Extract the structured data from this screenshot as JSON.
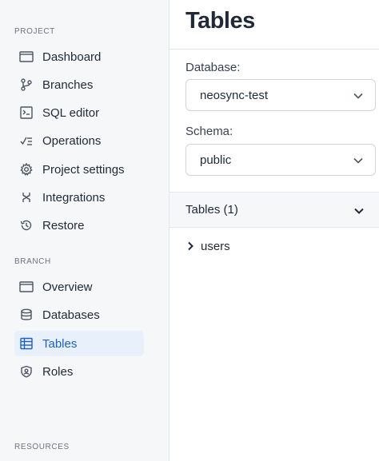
{
  "sidebar": {
    "project_label": "PROJECT",
    "project_items": [
      {
        "label": "Dashboard",
        "icon": "dashboard-icon"
      },
      {
        "label": "Branches",
        "icon": "branches-icon"
      },
      {
        "label": "SQL editor",
        "icon": "sql-editor-icon"
      },
      {
        "label": "Operations",
        "icon": "operations-icon"
      },
      {
        "label": "Project settings",
        "icon": "settings-gear-icon"
      },
      {
        "label": "Integrations",
        "icon": "integrations-icon"
      },
      {
        "label": "Restore",
        "icon": "restore-icon"
      }
    ],
    "branch_label": "BRANCH",
    "branch_items": [
      {
        "label": "Overview",
        "icon": "overview-icon"
      },
      {
        "label": "Databases",
        "icon": "database-icon"
      },
      {
        "label": "Tables",
        "icon": "table-icon",
        "active": true
      },
      {
        "label": "Roles",
        "icon": "roles-icon"
      }
    ],
    "resources_label": "RESOURCES"
  },
  "main": {
    "title": "Tables",
    "database_label": "Database:",
    "database_value": "neosync-test",
    "schema_label": "Schema:",
    "schema_value": "public",
    "tables_section_label": "Tables (1)",
    "tables": [
      "users"
    ]
  },
  "colors": {
    "sidebar_bg": "#f6f7f9",
    "active_bg": "#e8f0fb",
    "active_text": "#1f5fbf",
    "text": "#1f2937"
  }
}
